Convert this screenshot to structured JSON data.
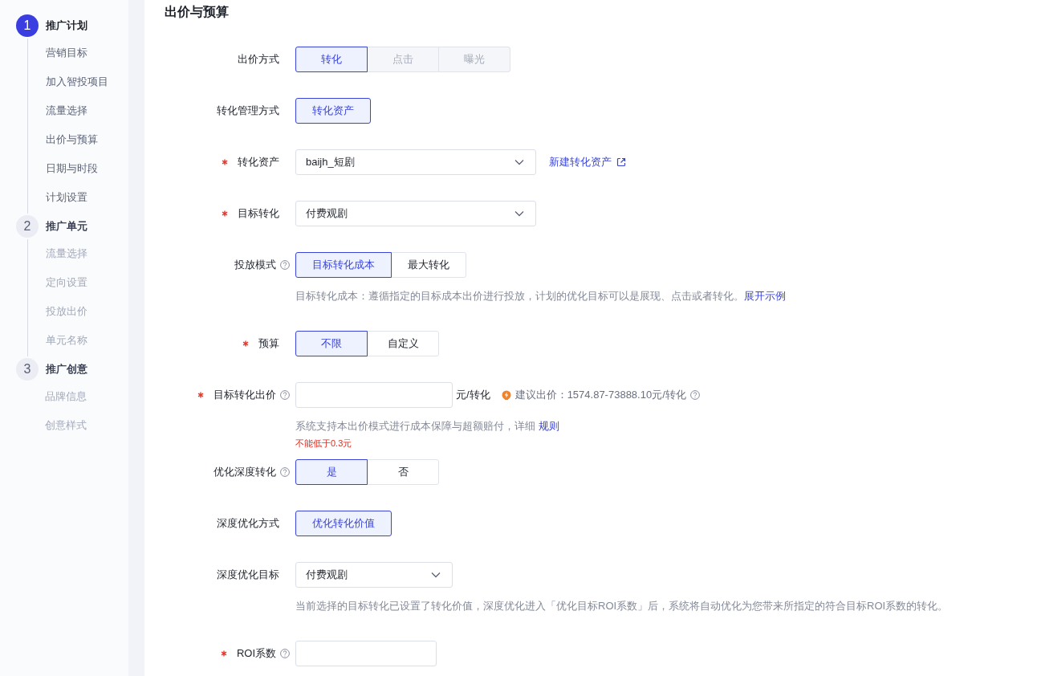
{
  "sidebar": {
    "steps": [
      {
        "number": "1",
        "label": "推广计划",
        "selected": true,
        "items": [
          {
            "label": "营销目标",
            "disabled": false
          },
          {
            "label": "加入智投项目",
            "disabled": false
          },
          {
            "label": "流量选择",
            "disabled": false
          },
          {
            "label": "出价与预算",
            "disabled": false
          },
          {
            "label": "日期与时段",
            "disabled": false
          },
          {
            "label": "计划设置",
            "disabled": false
          }
        ]
      },
      {
        "number": "2",
        "label": "推广单元",
        "selected": false,
        "items": [
          {
            "label": "流量选择",
            "disabled": true
          },
          {
            "label": "定向设置",
            "disabled": true
          },
          {
            "label": "投放出价",
            "disabled": true
          },
          {
            "label": "单元名称",
            "disabled": true
          }
        ]
      },
      {
        "number": "3",
        "label": "推广创意",
        "selected": false,
        "items": [
          {
            "label": "品牌信息",
            "disabled": true
          },
          {
            "label": "创意样式",
            "disabled": true
          }
        ]
      }
    ]
  },
  "section": {
    "title": "出价与预算",
    "rows": [
      {
        "kind": "segmented",
        "label": "出价方式",
        "required": false,
        "help": false,
        "options": [
          {
            "label": "转化",
            "selected": true,
            "disabled": false
          },
          {
            "label": "点击",
            "selected": false,
            "disabled": true
          },
          {
            "label": "曝光",
            "selected": false,
            "disabled": true
          }
        ]
      },
      {
        "kind": "segmented",
        "label": "转化管理方式",
        "required": false,
        "help": false,
        "options": [
          {
            "label": "转化资产",
            "selected": true,
            "disabled": false
          }
        ]
      },
      {
        "kind": "select",
        "label": "转化资产",
        "required": true,
        "help": false,
        "value": "baijh_短剧",
        "link": "新建转化资产"
      },
      {
        "kind": "select",
        "label": "目标转化",
        "required": true,
        "help": false,
        "value": "付费观剧"
      },
      {
        "kind": "segmented",
        "label": "投放模式",
        "required": false,
        "help": true,
        "options": [
          {
            "label": "目标转化成本",
            "selected": true,
            "disabled": false
          },
          {
            "label": "最大转化",
            "selected": false,
            "disabled": false
          }
        ],
        "hint": {
          "text": "目标转化成本：遵循指定的目标成本出价进行投放，计划的优化目标可以是展现、点击或者转化。",
          "link": "展开示例"
        }
      },
      {
        "kind": "segmented",
        "label": "预算",
        "required": true,
        "help": false,
        "options": [
          {
            "label": "不限",
            "selected": true,
            "disabled": false
          },
          {
            "label": "自定义",
            "selected": false,
            "disabled": false
          }
        ]
      },
      {
        "kind": "input",
        "label": "目标转化出价",
        "required": true,
        "help": true,
        "unit": "元/转化",
        "suggestion": "建议出价：1574.87-73888.10元/转化",
        "hint": {
          "text": "系统支持本出价模式进行成本保障与超额赔付，详细 ",
          "link": "规则"
        },
        "error": "不能低于0.3元"
      },
      {
        "kind": "segmented",
        "label": "优化深度转化",
        "required": false,
        "help": true,
        "options": [
          {
            "label": "是",
            "selected": true,
            "disabled": false
          },
          {
            "label": "否",
            "selected": false,
            "disabled": false
          }
        ]
      },
      {
        "kind": "segmented",
        "label": "深度优化方式",
        "required": false,
        "help": false,
        "options": [
          {
            "label": "优化转化价值",
            "selected": true,
            "disabled": false
          }
        ]
      },
      {
        "kind": "select",
        "label": "深度优化目标",
        "required": false,
        "help": false,
        "value": "付费观剧",
        "hint": {
          "text": "当前选择的目标转化已设置了转化价值，深度优化进入「优化目标ROI系数」后，系统将自动优化为您带来所指定的符合目标ROI系数的转化。"
        }
      },
      {
        "kind": "input",
        "label": "ROI系数",
        "required": true,
        "help": true
      }
    ]
  }
}
